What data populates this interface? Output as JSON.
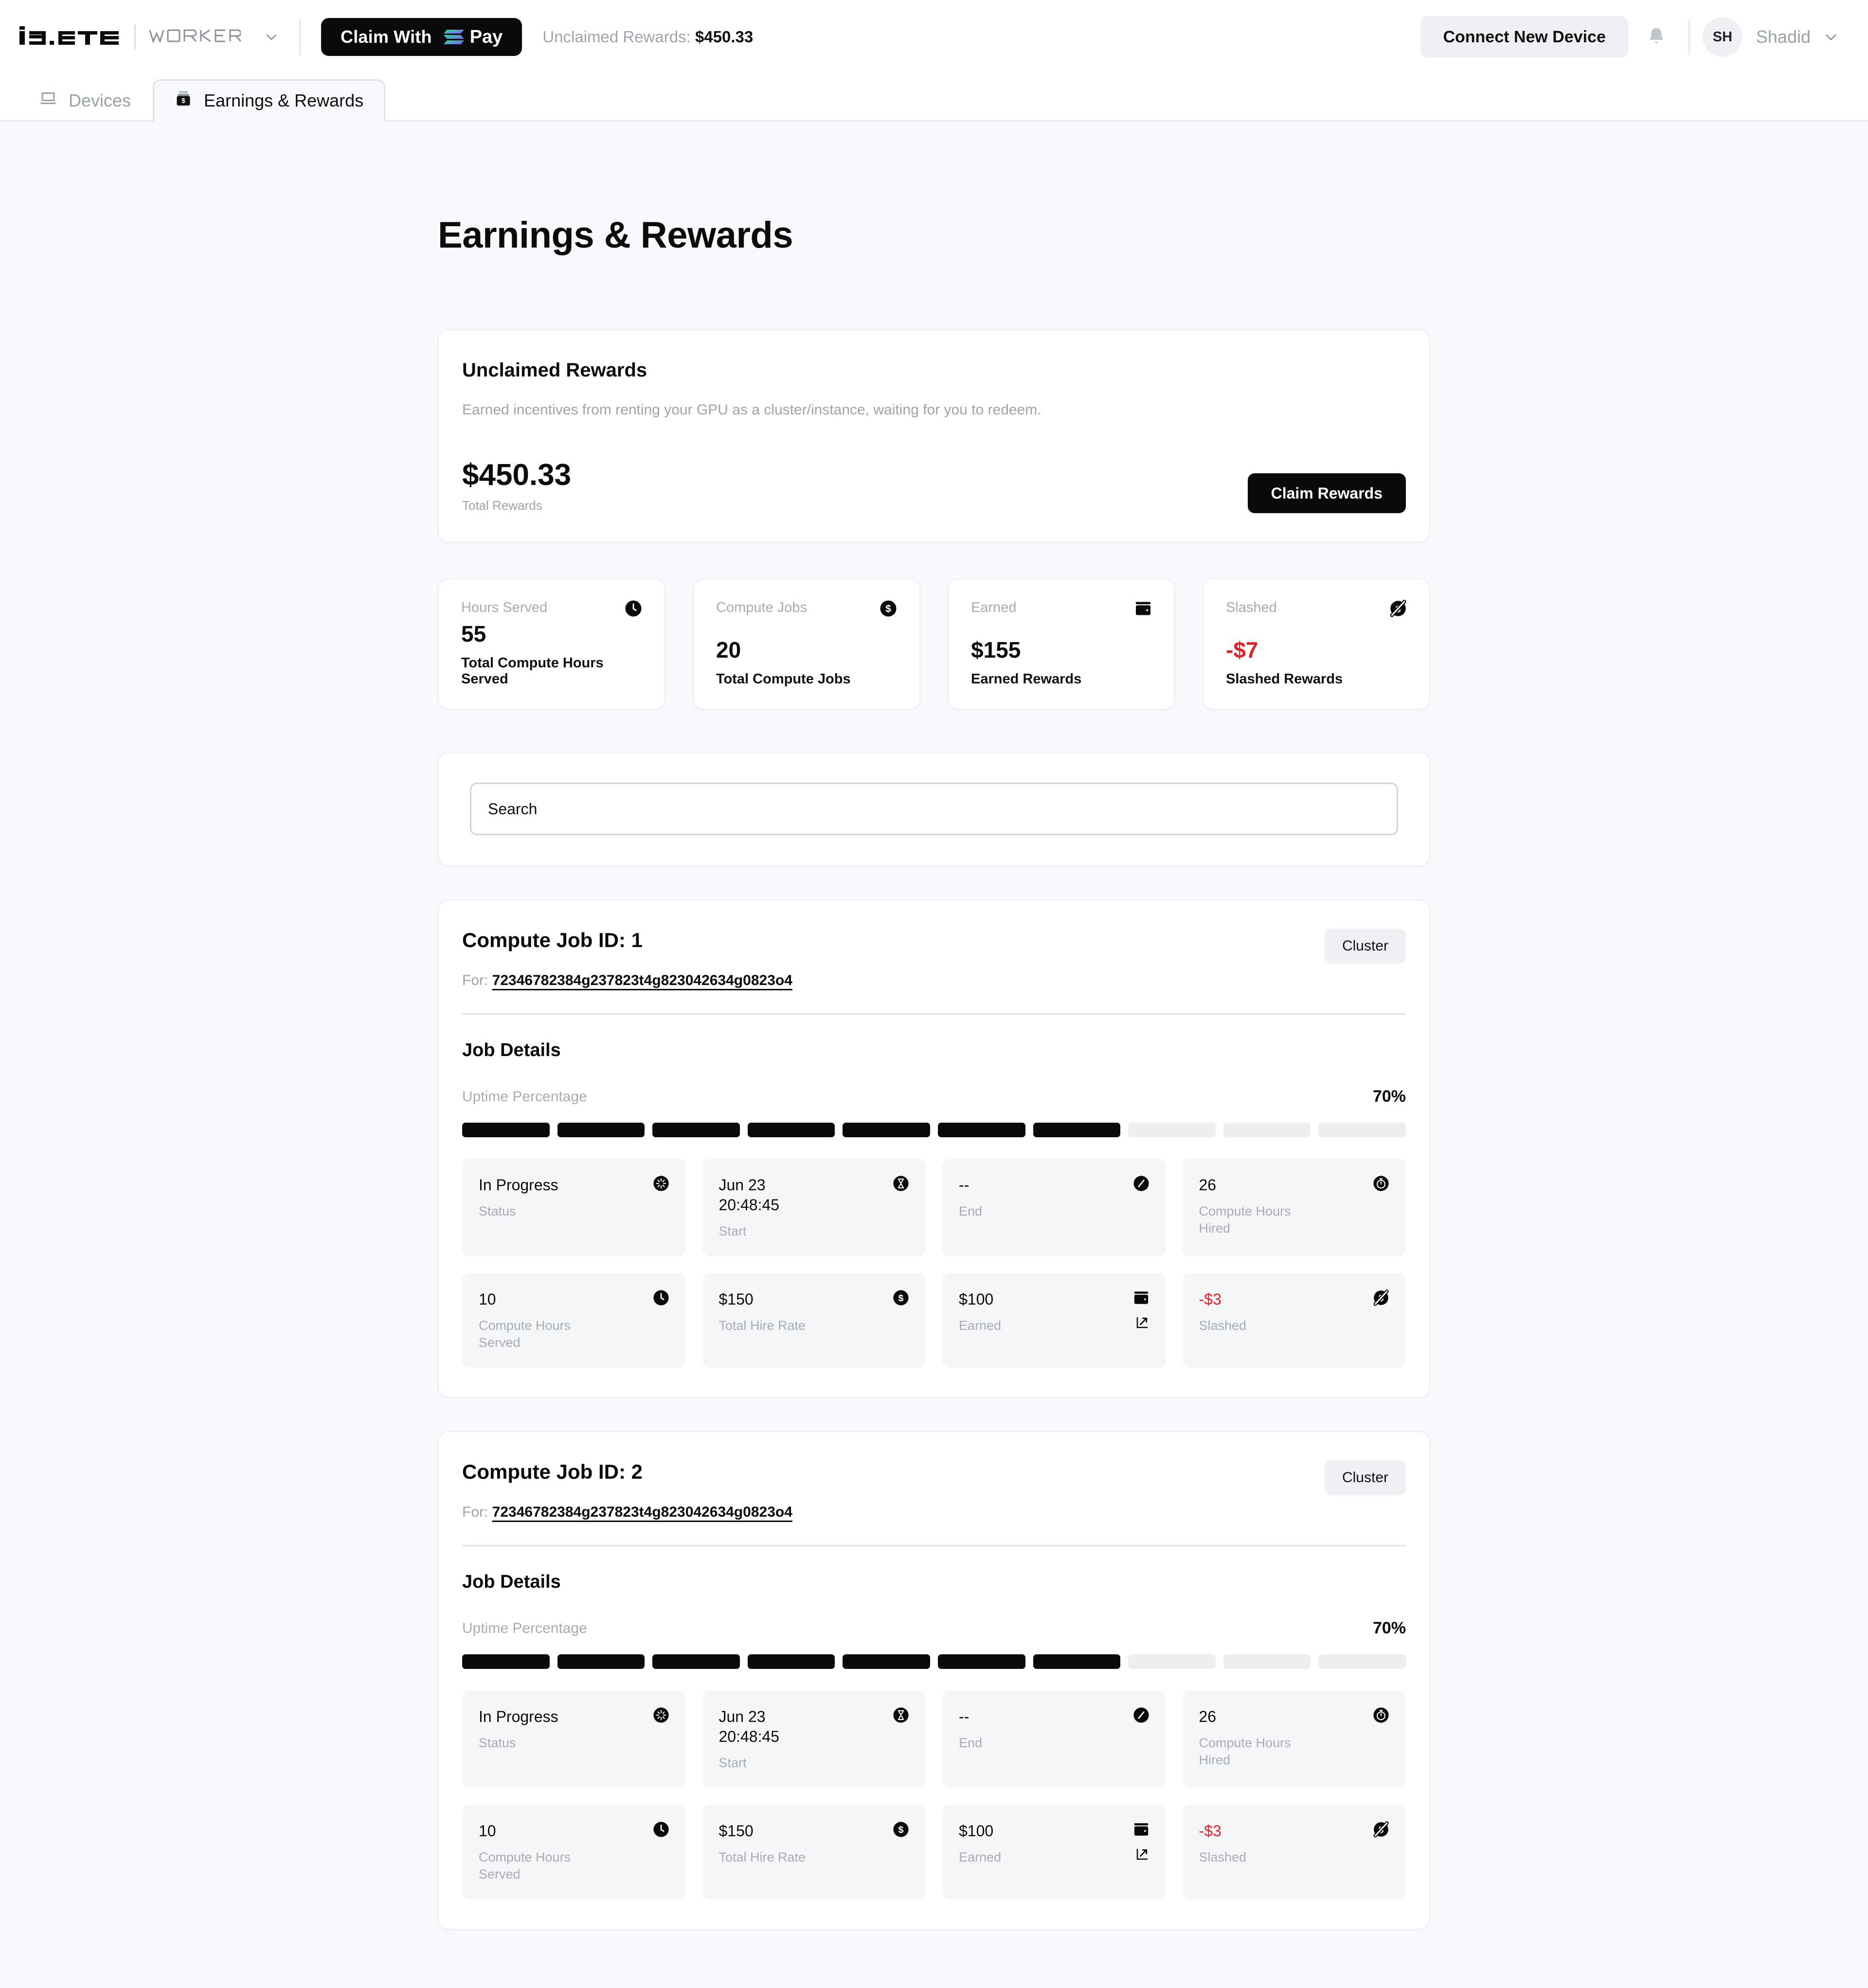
{
  "header": {
    "brand_primary": "iO.NET",
    "brand_secondary": "WORKER",
    "brand_caret": "chevron-down-icon",
    "claim_with_label": "Claim With",
    "solana_pay_label": "Pay",
    "unclaimed_label": "Unclaimed Rewards:",
    "unclaimed_value": "$450.33",
    "connect_button": "Connect New Device",
    "bell": "bell-icon",
    "avatar_initials": "SH",
    "username": "Shadid",
    "user_caret": "chevron-down-icon"
  },
  "tabs": [
    {
      "label": "Devices",
      "icon": "laptop-icon",
      "active": false
    },
    {
      "label": "Earnings & Rewards",
      "icon": "cash-register-icon",
      "active": true
    }
  ],
  "page": {
    "title": "Earnings & Rewards"
  },
  "unclaimed_card": {
    "title": "Unclaimed Rewards",
    "subtitle": "Earned incentives from renting your GPU as a cluster/instance, waiting for you to redeem.",
    "amount": "$450.33",
    "amount_label": "Total Rewards",
    "button": "Claim Rewards"
  },
  "stats": [
    {
      "label": "Hours Served",
      "icon": "clock-icon",
      "value": "55",
      "caption": "Total Compute Hours Served",
      "negative": false
    },
    {
      "label": "Compute Jobs",
      "icon": "dollar-coin-icon",
      "value": "20",
      "caption": "Total Compute Jobs",
      "negative": false
    },
    {
      "label": "Earned",
      "icon": "wallet-icon",
      "value": "$155",
      "caption": "Earned Rewards",
      "negative": false
    },
    {
      "label": "Slashed",
      "icon": "slashed-coin-icon",
      "value": "-$7",
      "caption": "Slashed Rewards",
      "negative": true
    }
  ],
  "search": {
    "placeholder": "Search",
    "value": ""
  },
  "jobs": [
    {
      "title": "Compute Job ID: 1",
      "for_label": "For:",
      "for_hash": "72346782384g237823t4g823042634g0823o4",
      "chip": "Cluster",
      "details_title": "Job Details",
      "uptime_label": "Uptime Percentage",
      "uptime_pct": "70%",
      "uptime_segments_total": 10,
      "uptime_segments_filled": 7,
      "tiles": [
        {
          "value": "In Progress",
          "caption": "Status",
          "icon": "spinner-icon",
          "negative": false,
          "ext": false
        },
        {
          "value": "Jun 23\n20:48:45",
          "caption": "Start",
          "icon": "hourglass-icon",
          "negative": false,
          "ext": false
        },
        {
          "value": "--",
          "caption": "End",
          "icon": "slash-icon",
          "negative": false,
          "ext": false
        },
        {
          "value": "26",
          "caption": "Compute Hours\nHired",
          "icon": "stopwatch-icon",
          "negative": false,
          "ext": false
        },
        {
          "value": "10",
          "caption": "Compute Hours\nServed",
          "icon": "clock-icon",
          "negative": false,
          "ext": false
        },
        {
          "value": "$150",
          "caption": "Total Hire Rate",
          "icon": "dollar-coin-icon",
          "negative": false,
          "ext": false
        },
        {
          "value": "$100",
          "caption": "Earned",
          "icon": "wallet-icon",
          "negative": false,
          "ext": true
        },
        {
          "value": "-$3",
          "caption": "Slashed",
          "icon": "slashed-coin-icon",
          "negative": true,
          "ext": false
        }
      ]
    },
    {
      "title": "Compute Job ID: 2",
      "for_label": "For:",
      "for_hash": "72346782384g237823t4g823042634g0823o4",
      "chip": "Cluster",
      "details_title": "Job Details",
      "uptime_label": "Uptime Percentage",
      "uptime_pct": "70%",
      "uptime_segments_total": 10,
      "uptime_segments_filled": 7,
      "tiles": [
        {
          "value": "In Progress",
          "caption": "Status",
          "icon": "spinner-icon",
          "negative": false,
          "ext": false
        },
        {
          "value": "Jun 23\n20:48:45",
          "caption": "Start",
          "icon": "hourglass-icon",
          "negative": false,
          "ext": false
        },
        {
          "value": "--",
          "caption": "End",
          "icon": "slash-icon",
          "negative": false,
          "ext": false
        },
        {
          "value": "26",
          "caption": "Compute Hours\nHired",
          "icon": "stopwatch-icon",
          "negative": false,
          "ext": false
        },
        {
          "value": "10",
          "caption": "Compute Hours\nServed",
          "icon": "clock-icon",
          "negative": false,
          "ext": false
        },
        {
          "value": "$150",
          "caption": "Total Hire Rate",
          "icon": "dollar-coin-icon",
          "negative": false,
          "ext": false
        },
        {
          "value": "$100",
          "caption": "Earned",
          "icon": "wallet-icon",
          "negative": false,
          "ext": true
        },
        {
          "value": "-$3",
          "caption": "Slashed",
          "icon": "slashed-coin-icon",
          "negative": true,
          "ext": false
        }
      ]
    }
  ],
  "colors": {
    "accent_black": "#0a0a0a",
    "negative_red": "#e0222a",
    "page_bg": "#f7f9fc",
    "muted_text": "#9ea3ab",
    "tile_bg": "#f5f6f8",
    "solana_teal": "#14f195",
    "solana_purple": "#9945ff"
  }
}
